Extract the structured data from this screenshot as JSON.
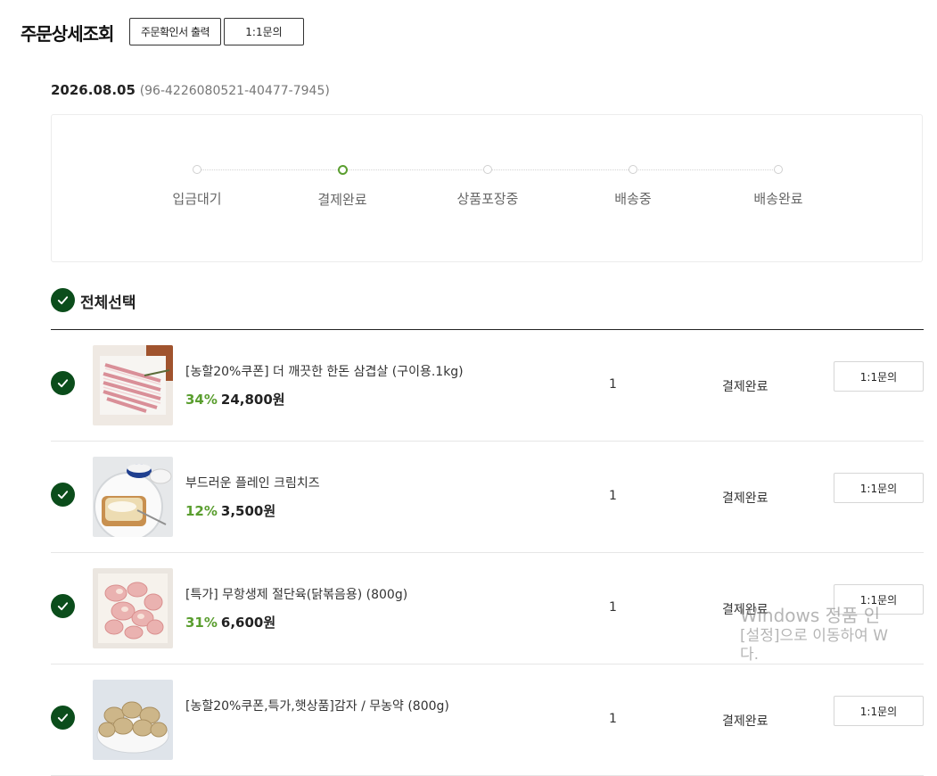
{
  "header": {
    "title": "주문상세조회",
    "print_button": "주문확인서 출력",
    "inquiry_button": "1:1문의"
  },
  "order": {
    "date": "2026.08.05",
    "number": "(96-4226080521-40477-7945)"
  },
  "tracker": {
    "steps": [
      {
        "label": "입금대기",
        "active": false
      },
      {
        "label": "결제완료",
        "active": true
      },
      {
        "label": "상품포장중",
        "active": false
      },
      {
        "label": "배송중",
        "active": false
      },
      {
        "label": "배송완료",
        "active": false
      }
    ]
  },
  "select_all": {
    "label": "전체선택",
    "checked": true
  },
  "products": [
    {
      "name": "[농할20%쿠폰] 더 깨끗한 한돈 삼겹살 (구이용.1kg)",
      "discount": "34%",
      "price": "24,800원",
      "qty": "1",
      "status": "결제완료",
      "button": "1:1문의",
      "image_icon": "pork-belly-image"
    },
    {
      "name": "부드러운 플레인 크림치즈",
      "discount": "12%",
      "price": "3,500원",
      "qty": "1",
      "status": "결제완료",
      "button": "1:1문의",
      "image_icon": "cream-cheese-image"
    },
    {
      "name": "[특가] 무항생제 절단육(닭볶음용) (800g)",
      "discount": "31%",
      "price": "6,600원",
      "qty": "1",
      "status": "결제완료",
      "button": "1:1문의",
      "image_icon": "chicken-cuts-image"
    },
    {
      "name": "[농할20%쿠폰,특가,햇상품]감자 / 무농약 (800g)",
      "discount": "",
      "price": "",
      "qty": "1",
      "status": "결제완료",
      "button": "1:1문의",
      "image_icon": "potato-image"
    }
  ],
  "watermark": {
    "line1": "Windows 정품 인",
    "line2": "[설정]으로 이동하여 W",
    "line3": "다."
  },
  "colors": {
    "check_green": "#0b4d1b",
    "discount_green": "#5a9e2f"
  }
}
